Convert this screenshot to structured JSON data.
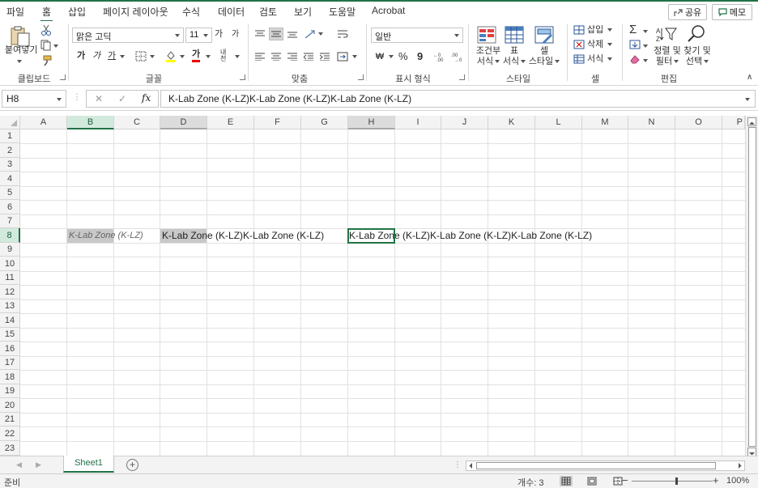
{
  "tabs": [
    "파일",
    "홈",
    "삽입",
    "페이지 레이아웃",
    "수식",
    "데이터",
    "검토",
    "보기",
    "도움말",
    "Acrobat"
  ],
  "active_tab": "홈",
  "share_label": "공유",
  "memo_label": "메모",
  "ribbon": {
    "clipboard": {
      "paste": "붙여넣기",
      "label": "클립보드"
    },
    "font": {
      "name": "맑은 고딕",
      "size": "11",
      "bold": "가",
      "italic": "가",
      "underline": "가",
      "grow": "가",
      "shrink": "가",
      "label": "글꼴",
      "phonetic": "내천"
    },
    "alignment": {
      "label": "맞춤"
    },
    "number": {
      "format": "일반",
      "percent": "%",
      "comma": "9",
      "label": "표시 형식",
      "currency": "₩"
    },
    "styles": {
      "conditional": [
        "조건부",
        "서식"
      ],
      "table": [
        "표",
        "서식"
      ],
      "cell": [
        "셀",
        "스타일"
      ],
      "label": "스타일"
    },
    "cells": {
      "insert": "삽입",
      "delete": "삭제",
      "format": "서식",
      "label": "셀"
    },
    "editing": {
      "sortfilter": [
        "정렬 및",
        "필터"
      ],
      "findselect": [
        "찾기 및",
        "선택"
      ],
      "label": "편집"
    }
  },
  "formula_bar": {
    "name_box": "H8",
    "cancel": "✕",
    "enter": "✓",
    "fx": "fx",
    "value": "K-Lab Zone (K-LZ)K-Lab Zone (K-LZ)K-Lab Zone (K-LZ)"
  },
  "columns": [
    "A",
    "B",
    "C",
    "D",
    "E",
    "F",
    "G",
    "H",
    "I",
    "J",
    "K",
    "L",
    "M",
    "N",
    "O",
    "P"
  ],
  "rows": [
    "1",
    "2",
    "3",
    "4",
    "5",
    "6",
    "7",
    "8",
    "9",
    "10",
    "11",
    "12",
    "13",
    "14",
    "15",
    "16",
    "17",
    "18",
    "19",
    "20",
    "21",
    "22",
    "23"
  ],
  "cells": {
    "b8": "K-Lab Zone (K-LZ)",
    "d8": "K-Lab Zone (K-LZ)K-Lab Zone (K-LZ)",
    "h8": "K-Lab Zone (K-LZ)K-Lab Zone (K-LZ)K-Lab Zone (K-LZ)"
  },
  "sheet_tab": "Sheet1",
  "add_sheet": "+",
  "status": {
    "ready": "준비",
    "count": "개수: 3",
    "zoom": "100%"
  },
  "colors": {
    "accent": "#217346",
    "selected_fill": "#c8c8c8"
  }
}
